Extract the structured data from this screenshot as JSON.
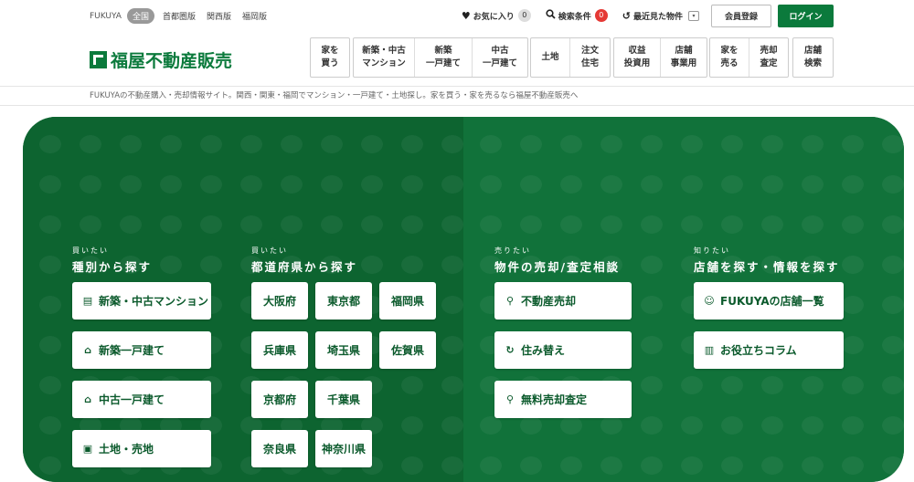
{
  "region": {
    "brand": "FUKUYA",
    "active": "全国",
    "links": [
      "首都圏版",
      "関西版",
      "福岡版"
    ]
  },
  "utils": {
    "favorites": {
      "label": "お気に入り",
      "count": "0"
    },
    "search_conditions": {
      "label": "検索条件",
      "count": "0"
    },
    "recent": {
      "label": "最近見た物件"
    }
  },
  "auth": {
    "register": "会員登録",
    "login": "ログイン"
  },
  "logo": {
    "text": "福屋不動産販売"
  },
  "nav": [
    [
      "家を\n買う"
    ],
    [
      "新築・中古\nマンション",
      "新築\n一戸建て",
      "中古\n一戸建て"
    ],
    [
      "土地",
      "注文\n住宅"
    ],
    [
      "収益\n投資用",
      "店舗\n事業用"
    ],
    [
      "家を\n売る",
      "売却\n査定"
    ],
    [
      "店舗\n検索"
    ]
  ],
  "subheader": "FUKUYAの不動産購入・売却情報サイト。関西・関東・福岡でマンション・一戸建て・土地探し。家を買う・家を売るなら福屋不動産販売へ",
  "hero": {
    "type": {
      "small": "買いたい",
      "heading": "種別から探す",
      "items": [
        "新築・中古マンション",
        "新築一戸建て",
        "中古一戸建て",
        "土地・売地"
      ]
    },
    "prefecture": {
      "small": "買いたい",
      "heading": "都道府県から探す",
      "items": [
        "大阪府",
        "東京都",
        "福岡県",
        "兵庫県",
        "埼玉県",
        "佐賀県",
        "京都府",
        "千葉県",
        "",
        "奈良県",
        "神奈川県",
        ""
      ]
    },
    "sell": {
      "small": "売りたい",
      "heading": "物件の売却/査定相談",
      "items": [
        "不動産売却",
        "住み替え",
        "無料売却査定"
      ]
    },
    "know": {
      "small": "知りたい",
      "heading": "店舗を探す・情報を探す",
      "items": [
        "FUKUYAの店舗一覧",
        "お役立ちコラム"
      ]
    }
  }
}
